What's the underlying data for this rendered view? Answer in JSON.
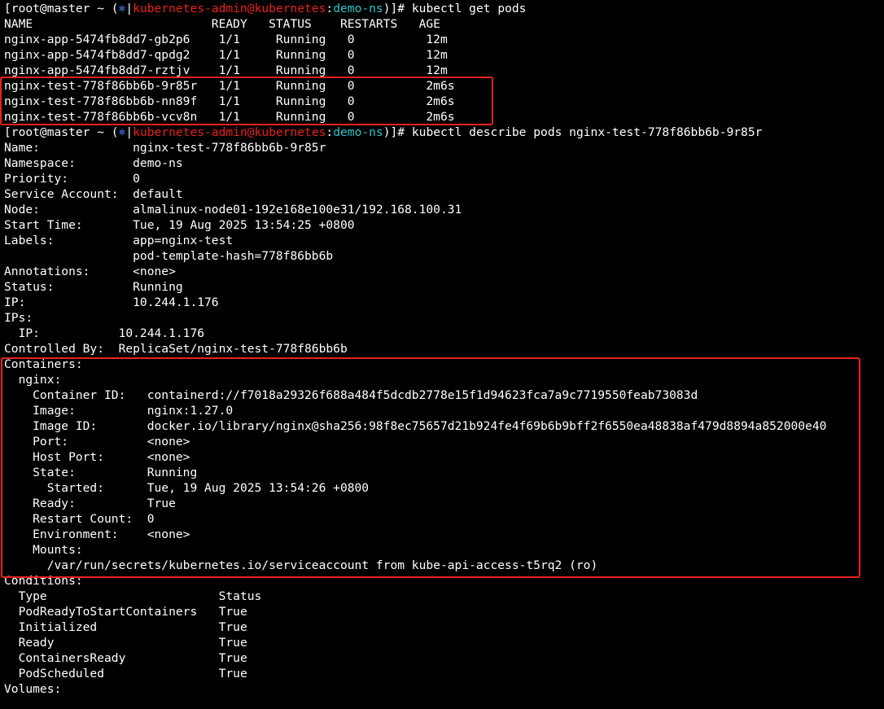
{
  "colors": {
    "background": "#000000",
    "text": "#ffffff",
    "prompt_user": "#e8221b",
    "prompt_namespace": "#2bc4c7",
    "prompt_icon": "#3a6fd8",
    "highlight": "#e8221b"
  },
  "prompt": {
    "prefix": "[root@master ~ (",
    "icon": "⎈",
    "separator": "|",
    "context": "kubernetes-admin@kubernetes",
    "colon": ":",
    "namespace": "demo-ns",
    "suffix": ")]# "
  },
  "commands": {
    "get_pods": "kubectl get pods",
    "describe_pod": "kubectl describe pods nginx-test-778f86bb6b-9r85r"
  },
  "get_pods": {
    "header": "NAME                         READY   STATUS    RESTARTS   AGE",
    "rows": [
      "nginx-app-5474fb8dd7-gb2p6    1/1     Running   0          12m",
      "nginx-app-5474fb8dd7-qpdg2    1/1     Running   0          12m",
      "nginx-app-5474fb8dd7-rztjv    1/1     Running   0          12m",
      "nginx-test-778f86bb6b-9r85r   1/1     Running   0          2m6s",
      "nginx-test-778f86bb6b-nn89f   1/1     Running   0          2m6s",
      "nginx-test-778f86bb6b-vcv8n   1/1     Running   0          2m6s"
    ]
  },
  "describe": {
    "lines": [
      "Name:             nginx-test-778f86bb6b-9r85r",
      "Namespace:        demo-ns",
      "Priority:         0",
      "Service Account:  default",
      "Node:             almalinux-node01-192e168e100e31/192.168.100.31",
      "Start Time:       Tue, 19 Aug 2025 13:54:25 +0800",
      "Labels:           app=nginx-test",
      "                  pod-template-hash=778f86bb6b",
      "Annotations:      <none>",
      "Status:           Running",
      "IP:               10.244.1.176",
      "IPs:",
      "  IP:           10.244.1.176",
      "Controlled By:  ReplicaSet/nginx-test-778f86bb6b",
      "Containers:",
      "  nginx:",
      "    Container ID:   containerd://f7018a29326f688a484f5dcdb2778e15f1d94623fca7a9c7719550feab73083d",
      "    Image:          nginx:1.27.0",
      "    Image ID:       docker.io/library/nginx@sha256:98f8ec75657d21b924fe4f69b6b9bff2f6550ea48838af479d8894a852000e40",
      "    Port:           <none>",
      "    Host Port:      <none>",
      "    State:          Running",
      "      Started:      Tue, 19 Aug 2025 13:54:26 +0800",
      "    Ready:          True",
      "    Restart Count:  0",
      "    Environment:    <none>",
      "    Mounts:",
      "      /var/run/secrets/kubernetes.io/serviceaccount from kube-api-access-t5rq2 (ro)",
      "Conditions:",
      "  Type                        Status",
      "  PodReadyToStartContainers   True",
      "  Initialized                 True",
      "  Ready                       True",
      "  ContainersReady             True",
      "  PodScheduled                True",
      "Volumes:"
    ]
  }
}
